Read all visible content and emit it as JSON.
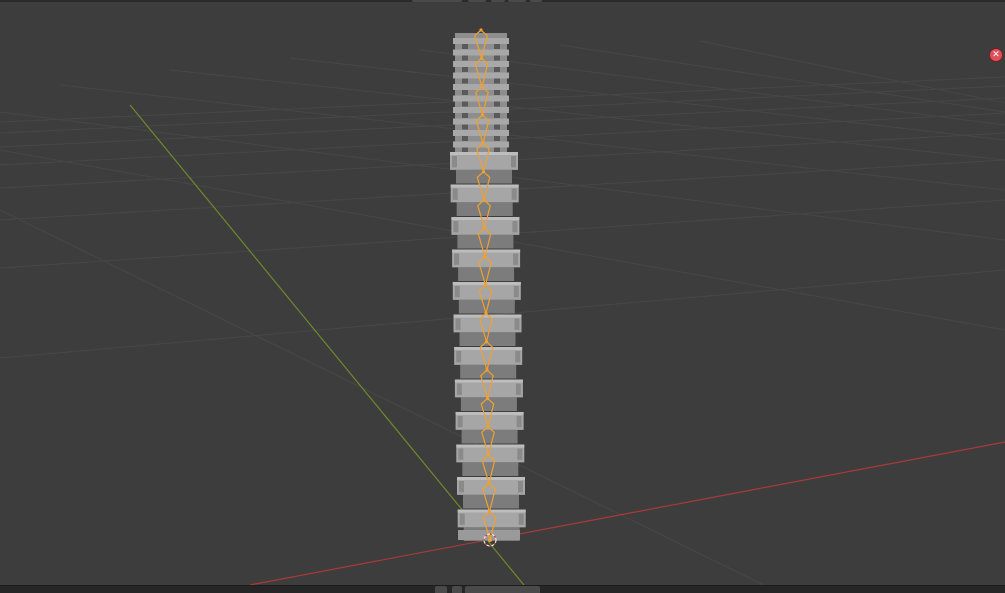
{
  "app": {
    "name": "3D Viewport"
  },
  "viewport": {
    "background": "#3d3d3d",
    "grid_color": "#4a4a4a",
    "x_axis_color": "#a83a3a",
    "y_axis_color": "#6b8a2c"
  },
  "object": {
    "mesh_color": "#9c9c9c",
    "bone_color": "#f0a030",
    "segments": 12
  },
  "icons": {
    "close": "close-icon",
    "origin": "origin-cursor-icon"
  }
}
